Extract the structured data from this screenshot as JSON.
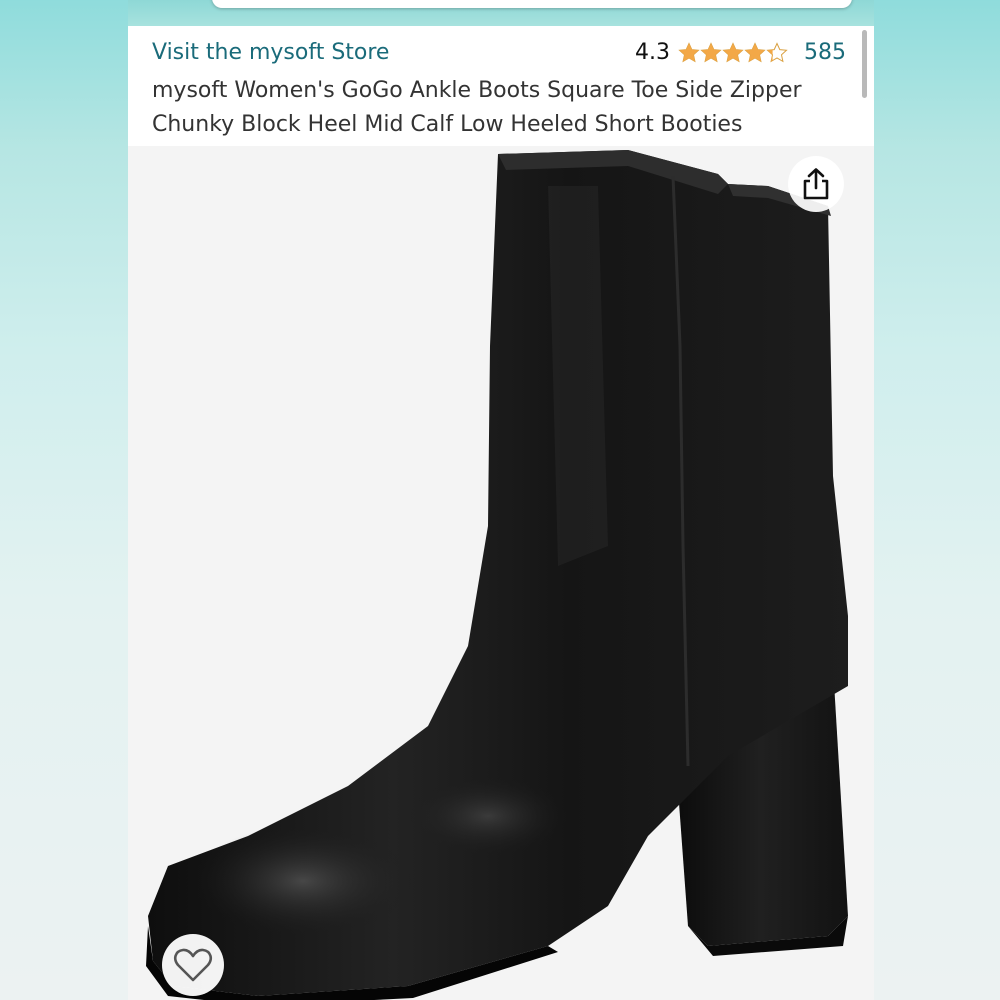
{
  "product": {
    "store_link": "Visit the mysoft Store",
    "rating": "4.3",
    "rating_value": 4.3,
    "rating_max": 5,
    "review_count": "585",
    "title": "mysoft Women's GoGo Ankle Boots Square Toe Side Zipper Chunky Block Heel Mid Calf Low Heeled Short Booties"
  },
  "icons": {
    "share": "share-icon",
    "wishlist": "heart-icon",
    "star": "star-icon"
  },
  "colors": {
    "link": "#1a6b7a",
    "star": "#f3a847",
    "text": "#333333",
    "boot": "#141414"
  }
}
